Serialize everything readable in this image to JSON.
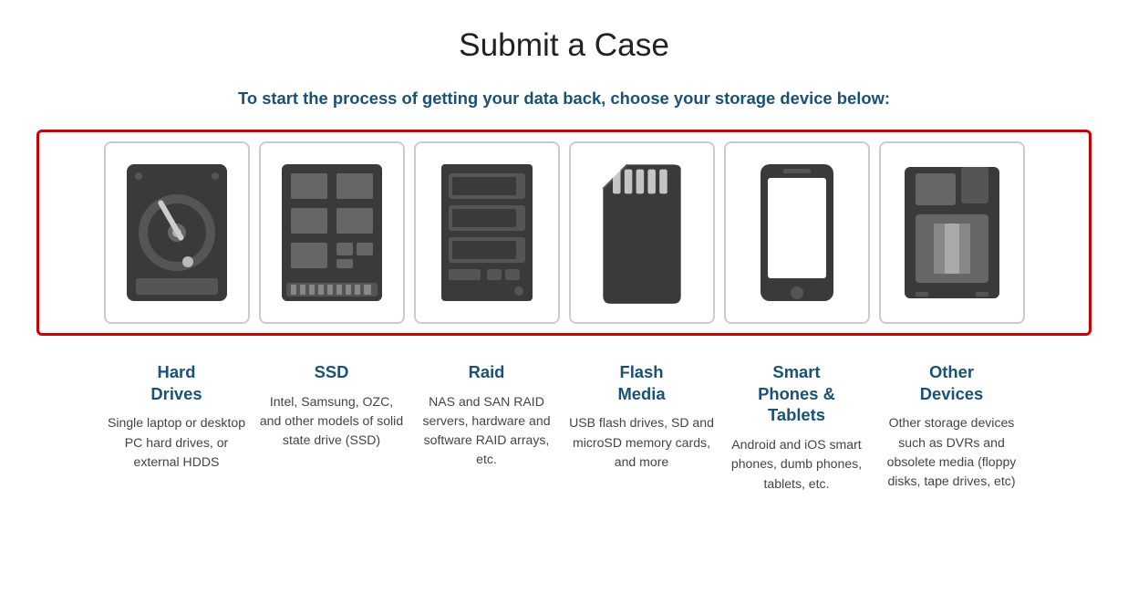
{
  "page": {
    "title": "Submit a Case",
    "subtitle": "To start the process of getting your data back, choose your storage device below:"
  },
  "devices": [
    {
      "id": "hard-drives",
      "label": "Hard\nDrives",
      "description": "Single laptop or desktop PC hard drives, or external HDDS"
    },
    {
      "id": "ssd",
      "label": "SSD",
      "description": "Intel, Samsung, OZC, and other models of solid state drive (SSD)"
    },
    {
      "id": "raid",
      "label": "Raid",
      "description": "NAS and SAN RAID servers, hardware and software RAID arrays, etc."
    },
    {
      "id": "flash-media",
      "label": "Flash\nMedia",
      "description": "USB flash drives, SD and microSD memory cards, and more"
    },
    {
      "id": "smart-phones",
      "label": "Smart\nPhones &\nTablets",
      "description": "Android and iOS smart phones, dumb phones, tablets, etc."
    },
    {
      "id": "other-devices",
      "label": "Other\nDevices",
      "description": "Other storage devices such as DVRs and obsolete media (floppy disks, tape drives, etc)"
    }
  ]
}
